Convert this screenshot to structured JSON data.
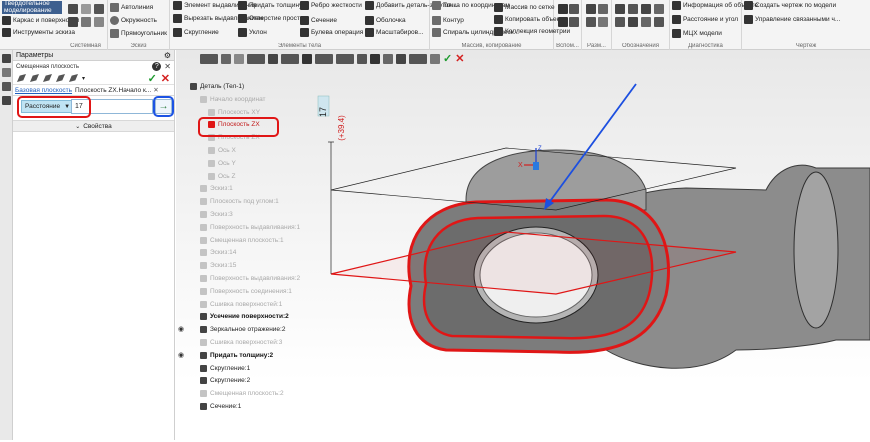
{
  "ribbon": {
    "active_tab": "Твердотельное моделирование",
    "items_col1": [
      "Каркас и поверхности",
      "Инструменты эскиза"
    ],
    "items_sketch": [
      "Автолиния",
      "Окружность",
      "Прямоугольник"
    ],
    "items_elements": [
      "Элемент выдавливания",
      "Вырезать выдавливанием",
      "Скругление",
      "Придать толщину",
      "Отверстие простое",
      "Уклон",
      "Ребро жесткости",
      "Сечение",
      "Булева операция",
      "Добавить деталь-заготов...",
      "Оболочка",
      "Масштабиров..."
    ],
    "items_copy": [
      "Точка по координатам",
      "Контур",
      "Спираль цилиндрическ...",
      "Массив по сетке",
      "Копировать объекты",
      "Коллекция геометрии"
    ],
    "items_diag": [
      "Информация об объекте",
      "Расстояние и угол",
      "МЦХ модели"
    ],
    "items_drawing": [
      "Создать чертеж по модели",
      "Управление связанными ч..."
    ],
    "group_titles": [
      "Системная",
      "Эскиз",
      "Элементы тела",
      "Массив, копирование",
      "Вспом...",
      "Разм...",
      "Обозначения",
      "Диагностика",
      "Чертеж"
    ]
  },
  "panel": {
    "title": "Параметры",
    "subtitle": "Смещенная плоскость",
    "base_label": "Базовая плоскость",
    "base_value": "Плоскость ZX.Начало к...",
    "mode_label": "Расстояние",
    "distance_value": "17",
    "props_label": "Свойства"
  },
  "tree": {
    "items": [
      {
        "label": "Деталь (Тел-1)",
        "style": "normal",
        "indent": 12
      },
      {
        "label": "Начало координат",
        "style": "faded",
        "indent": 22
      },
      {
        "label": "Плоскость XY",
        "style": "faded",
        "indent": 30
      },
      {
        "label": "Плоскость ZX",
        "style": "faded",
        "indent": 30
      },
      {
        "label": "Плоскость ZX",
        "style": "faded",
        "indent": 30
      },
      {
        "label": "Ось X",
        "style": "faded",
        "indent": 30
      },
      {
        "label": "Ось Y",
        "style": "faded",
        "indent": 30
      },
      {
        "label": "Ось Z",
        "style": "faded",
        "indent": 30
      },
      {
        "label": "Эскиз:1",
        "style": "faded",
        "indent": 22
      },
      {
        "label": "Плоскость под углом:1",
        "style": "faded",
        "indent": 22
      },
      {
        "label": "Эскиз:3",
        "style": "faded",
        "indent": 22
      },
      {
        "label": "Поверхность выдавливания:1",
        "style": "faded",
        "indent": 22
      },
      {
        "label": "Смещенная плоскость:1",
        "style": "faded",
        "indent": 22
      },
      {
        "label": "Эскиз:14",
        "style": "faded",
        "indent": 22
      },
      {
        "label": "Эскиз:15",
        "style": "faded",
        "indent": 22
      },
      {
        "label": "Поверхность выдавливания:2",
        "style": "faded",
        "indent": 22
      },
      {
        "label": "Поверхность соединения:1",
        "style": "faded",
        "indent": 22
      },
      {
        "label": "Сшивка поверхностей:1",
        "style": "faded",
        "indent": 22
      },
      {
        "label": "Усечение поверхности:2",
        "style": "bold",
        "indent": 22
      },
      {
        "label": "Зеркальное отражение:2",
        "style": "normal",
        "indent": 22
      },
      {
        "label": "Сшивка поверхностей:3",
        "style": "faded",
        "indent": 22
      },
      {
        "label": "Придать толщину:2",
        "style": "bold",
        "indent": 22
      },
      {
        "label": "Скругление:1",
        "style": "normal",
        "indent": 22
      },
      {
        "label": "Скругление:2",
        "style": "normal",
        "indent": 22
      },
      {
        "label": "Смещенная плоскость:2",
        "style": "faded",
        "indent": 22
      },
      {
        "label": "Сечение:1",
        "style": "normal",
        "indent": 22
      }
    ]
  },
  "viewport": {
    "dimension_value": "17",
    "dimension_note": "(+39.4)",
    "axis_x": "X",
    "axis_z": "Z",
    "highlight_color": "#e01616",
    "arrow_color": "#1c4fe0"
  }
}
